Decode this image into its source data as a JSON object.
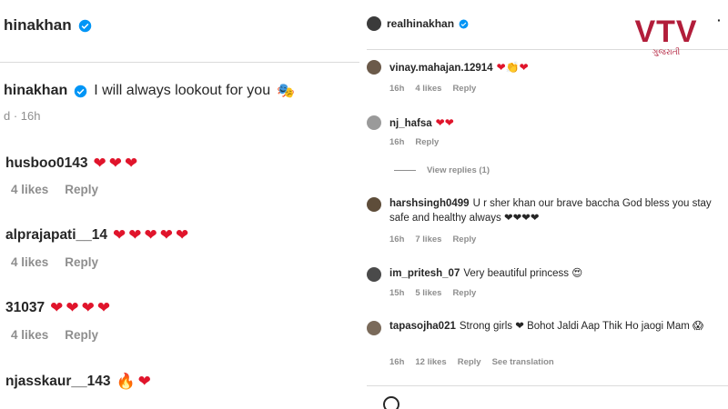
{
  "left": {
    "header_username": "hinakhan",
    "caption": {
      "username": "hinakhan",
      "text": "I will always lookout for you",
      "emoji": "🎭",
      "meta": "d · 16h"
    },
    "comments": [
      {
        "username": "husboo0143",
        "text": "❤❤❤",
        "likes": "4 likes",
        "reply": "Reply"
      },
      {
        "username": "alprajapati__14",
        "text": "❤❤❤❤❤",
        "likes": "4 likes",
        "reply": "Reply"
      },
      {
        "username": "31037",
        "text": "❤❤❤❤",
        "likes": "4 likes",
        "reply": "Reply"
      },
      {
        "username": "njasskaur__143",
        "text": "🔥❤",
        "likes": "",
        "reply": ""
      }
    ]
  },
  "right": {
    "header_username": "realhinakhan",
    "more": "·",
    "comments": [
      {
        "username": "vinay.mahajan.12914",
        "text": "❤👏❤",
        "time": "16h",
        "likes": "4 likes",
        "reply": "Reply"
      },
      {
        "username": "nj_hafsa",
        "text": "❤❤",
        "time": "16h",
        "likes": "",
        "reply": "Reply"
      },
      {
        "username": "harshsingh0499",
        "text": "U r sher khan our brave baccha God bless you stay safe and healthy always ❤❤❤❤",
        "time": "16h",
        "likes": "7 likes",
        "reply": "Reply"
      },
      {
        "username": "im_pritesh_07",
        "text": "Very beautiful princess 😍",
        "time": "15h",
        "likes": "5 likes",
        "reply": "Reply"
      },
      {
        "username": "tapasojha021",
        "text": "Strong girls ❤ Bohot Jaldi Aap Thik Ho jaogi Mam 😱",
        "time": "16h",
        "likes": "12 likes",
        "reply": "Reply",
        "translation": "See translation"
      }
    ],
    "view_replies": "View replies (1)"
  },
  "logo": {
    "mark": "VTV",
    "sub": "ગુજરાતી"
  },
  "colors": {
    "verified": "#0095f6",
    "heart": "#e0142b",
    "logo": "#b21d3a"
  }
}
